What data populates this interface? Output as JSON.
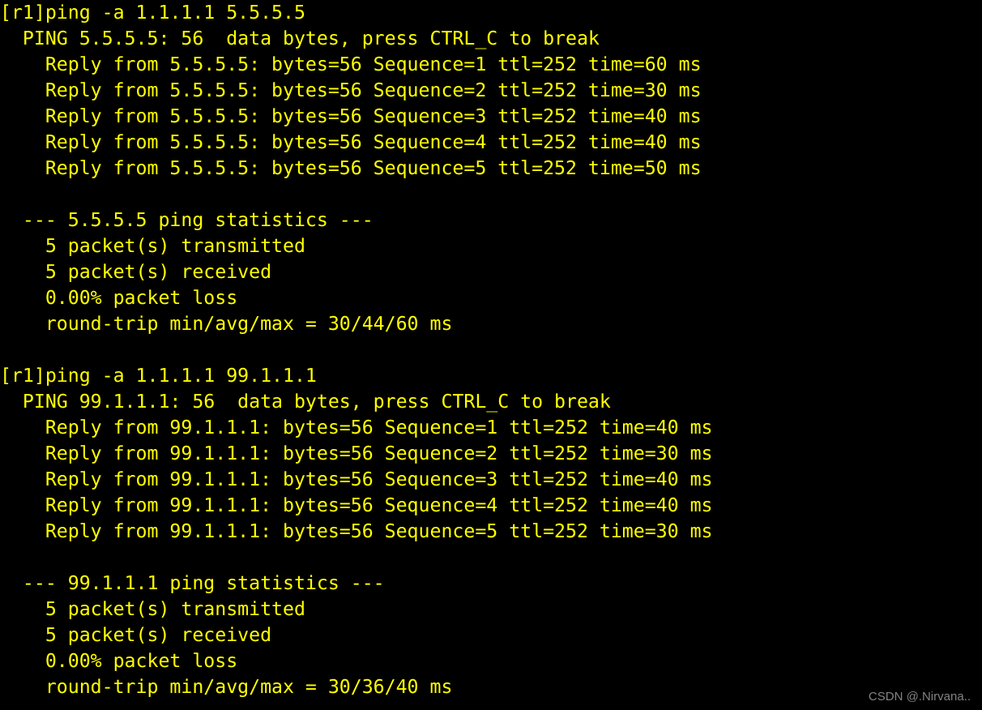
{
  "terminal": {
    "background_color": "#000000",
    "text_color": "#ffff00",
    "watermark_color": "#9a9a9a",
    "watermark": "CSDN @.Nirvana..",
    "lines": [
      "[r1]ping -a 1.1.1.1 5.5.5.5",
      "  PING 5.5.5.5: 56  data bytes, press CTRL_C to break",
      "    Reply from 5.5.5.5: bytes=56 Sequence=1 ttl=252 time=60 ms",
      "    Reply from 5.5.5.5: bytes=56 Sequence=2 ttl=252 time=30 ms",
      "    Reply from 5.5.5.5: bytes=56 Sequence=3 ttl=252 time=40 ms",
      "    Reply from 5.5.5.5: bytes=56 Sequence=4 ttl=252 time=40 ms",
      "    Reply from 5.5.5.5: bytes=56 Sequence=5 ttl=252 time=50 ms",
      "",
      "  --- 5.5.5.5 ping statistics ---",
      "    5 packet(s) transmitted",
      "    5 packet(s) received",
      "    0.00% packet loss",
      "    round-trip min/avg/max = 30/44/60 ms",
      "",
      "[r1]ping -a 1.1.1.1 99.1.1.1",
      "  PING 99.1.1.1: 56  data bytes, press CTRL_C to break",
      "    Reply from 99.1.1.1: bytes=56 Sequence=1 ttl=252 time=40 ms",
      "    Reply from 99.1.1.1: bytes=56 Sequence=2 ttl=252 time=30 ms",
      "    Reply from 99.1.1.1: bytes=56 Sequence=3 ttl=252 time=40 ms",
      "    Reply from 99.1.1.1: bytes=56 Sequence=4 ttl=252 time=40 ms",
      "    Reply from 99.1.1.1: bytes=56 Sequence=5 ttl=252 time=30 ms",
      "",
      "  --- 99.1.1.1 ping statistics ---",
      "    5 packet(s) transmitted",
      "    5 packet(s) received",
      "    0.00% packet loss",
      "    round-trip min/avg/max = 30/36/40 ms"
    ],
    "sessions": [
      {
        "prompt": "[r1]",
        "command": "ping -a 1.1.1.1 5.5.5.5",
        "source_ip": "1.1.1.1",
        "target_ip": "5.5.5.5",
        "data_bytes": "56",
        "break_hint": "press CTRL_C to break",
        "replies": [
          {
            "from": "5.5.5.5",
            "bytes": "56",
            "sequence": "1",
            "ttl": "252",
            "time_ms": "60"
          },
          {
            "from": "5.5.5.5",
            "bytes": "56",
            "sequence": "2",
            "ttl": "252",
            "time_ms": "30"
          },
          {
            "from": "5.5.5.5",
            "bytes": "56",
            "sequence": "3",
            "ttl": "252",
            "time_ms": "40"
          },
          {
            "from": "5.5.5.5",
            "bytes": "56",
            "sequence": "4",
            "ttl": "252",
            "time_ms": "40"
          },
          {
            "from": "5.5.5.5",
            "bytes": "56",
            "sequence": "5",
            "ttl": "252",
            "time_ms": "50"
          }
        ],
        "statistics": {
          "header": "--- 5.5.5.5 ping statistics ---",
          "transmitted": "5 packet(s) transmitted",
          "received": "5 packet(s) received",
          "loss": "0.00% packet loss",
          "round_trip": "round-trip min/avg/max = 30/44/60 ms"
        }
      },
      {
        "prompt": "[r1]",
        "command": "ping -a 1.1.1.1 99.1.1.1",
        "source_ip": "1.1.1.1",
        "target_ip": "99.1.1.1",
        "data_bytes": "56",
        "break_hint": "press CTRL_C to break",
        "replies": [
          {
            "from": "99.1.1.1",
            "bytes": "56",
            "sequence": "1",
            "ttl": "252",
            "time_ms": "40"
          },
          {
            "from": "99.1.1.1",
            "bytes": "56",
            "sequence": "2",
            "ttl": "252",
            "time_ms": "30"
          },
          {
            "from": "99.1.1.1",
            "bytes": "56",
            "sequence": "3",
            "ttl": "252",
            "time_ms": "40"
          },
          {
            "from": "99.1.1.1",
            "bytes": "56",
            "sequence": "4",
            "ttl": "252",
            "time_ms": "40"
          },
          {
            "from": "99.1.1.1",
            "bytes": "56",
            "sequence": "5",
            "ttl": "252",
            "time_ms": "30"
          }
        ],
        "statistics": {
          "header": "--- 99.1.1.1 ping statistics ---",
          "transmitted": "5 packet(s) transmitted",
          "received": "5 packet(s) received",
          "loss": "0.00% packet loss",
          "round_trip": "round-trip min/avg/max = 30/36/40 ms"
        }
      }
    ]
  }
}
